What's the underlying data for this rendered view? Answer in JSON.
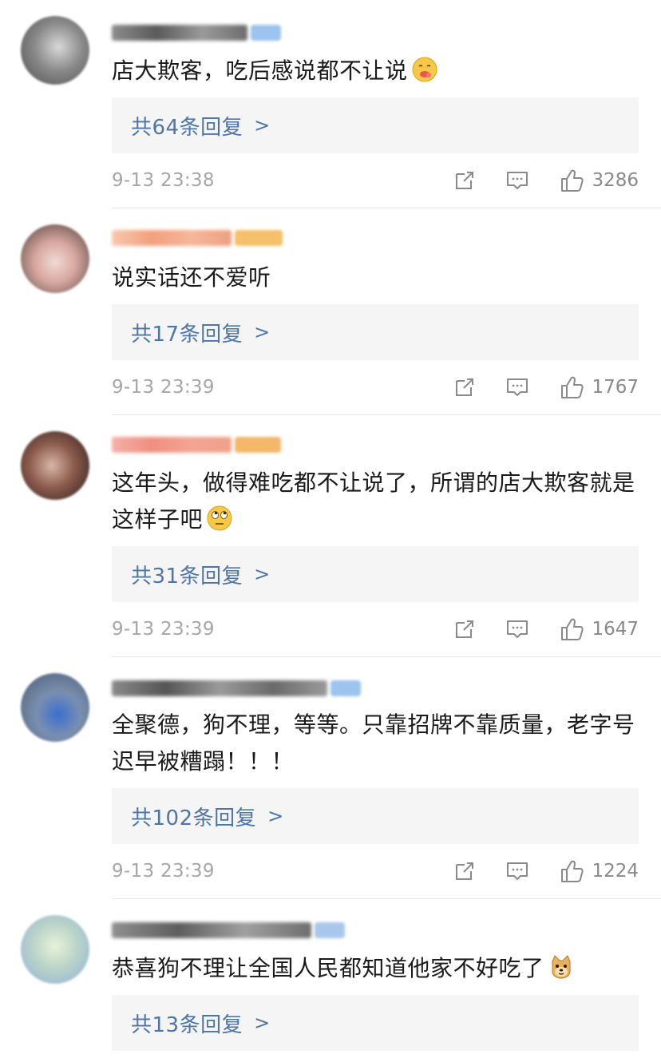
{
  "comments": [
    {
      "text": "店大欺客，吃后感说都不让说",
      "emoji": "yum-emoji",
      "replies": "共64条回复",
      "time": "9-13 23:38",
      "likes": "3286"
    },
    {
      "text": "说实话还不爱听",
      "emoji": "",
      "replies": "共17条回复",
      "time": "9-13 23:39",
      "likes": "1767"
    },
    {
      "text": "这年头，做得难吃都不让说了，所谓的店大欺客就是这样子吧",
      "emoji": "eye-roll-emoji",
      "replies": "共31条回复",
      "time": "9-13 23:39",
      "likes": "1647"
    },
    {
      "text": "全聚德，狗不理，等等。只靠招牌不靠质量，老字号迟早被糟蹋！！！",
      "emoji": "",
      "replies": "共102条回复",
      "time": "9-13 23:39",
      "likes": "1224"
    },
    {
      "text": "恭喜狗不理让全国人民都知道他家不好吃了",
      "emoji": "doge-emoji",
      "replies": "共13条回复",
      "time": "",
      "likes": ""
    }
  ],
  "reply_arrow": ">",
  "colors": {
    "link": "#4e75a8",
    "meta": "#a6a6a6",
    "reply_bg": "#f5f5f5",
    "divider": "#e6e6e6"
  }
}
